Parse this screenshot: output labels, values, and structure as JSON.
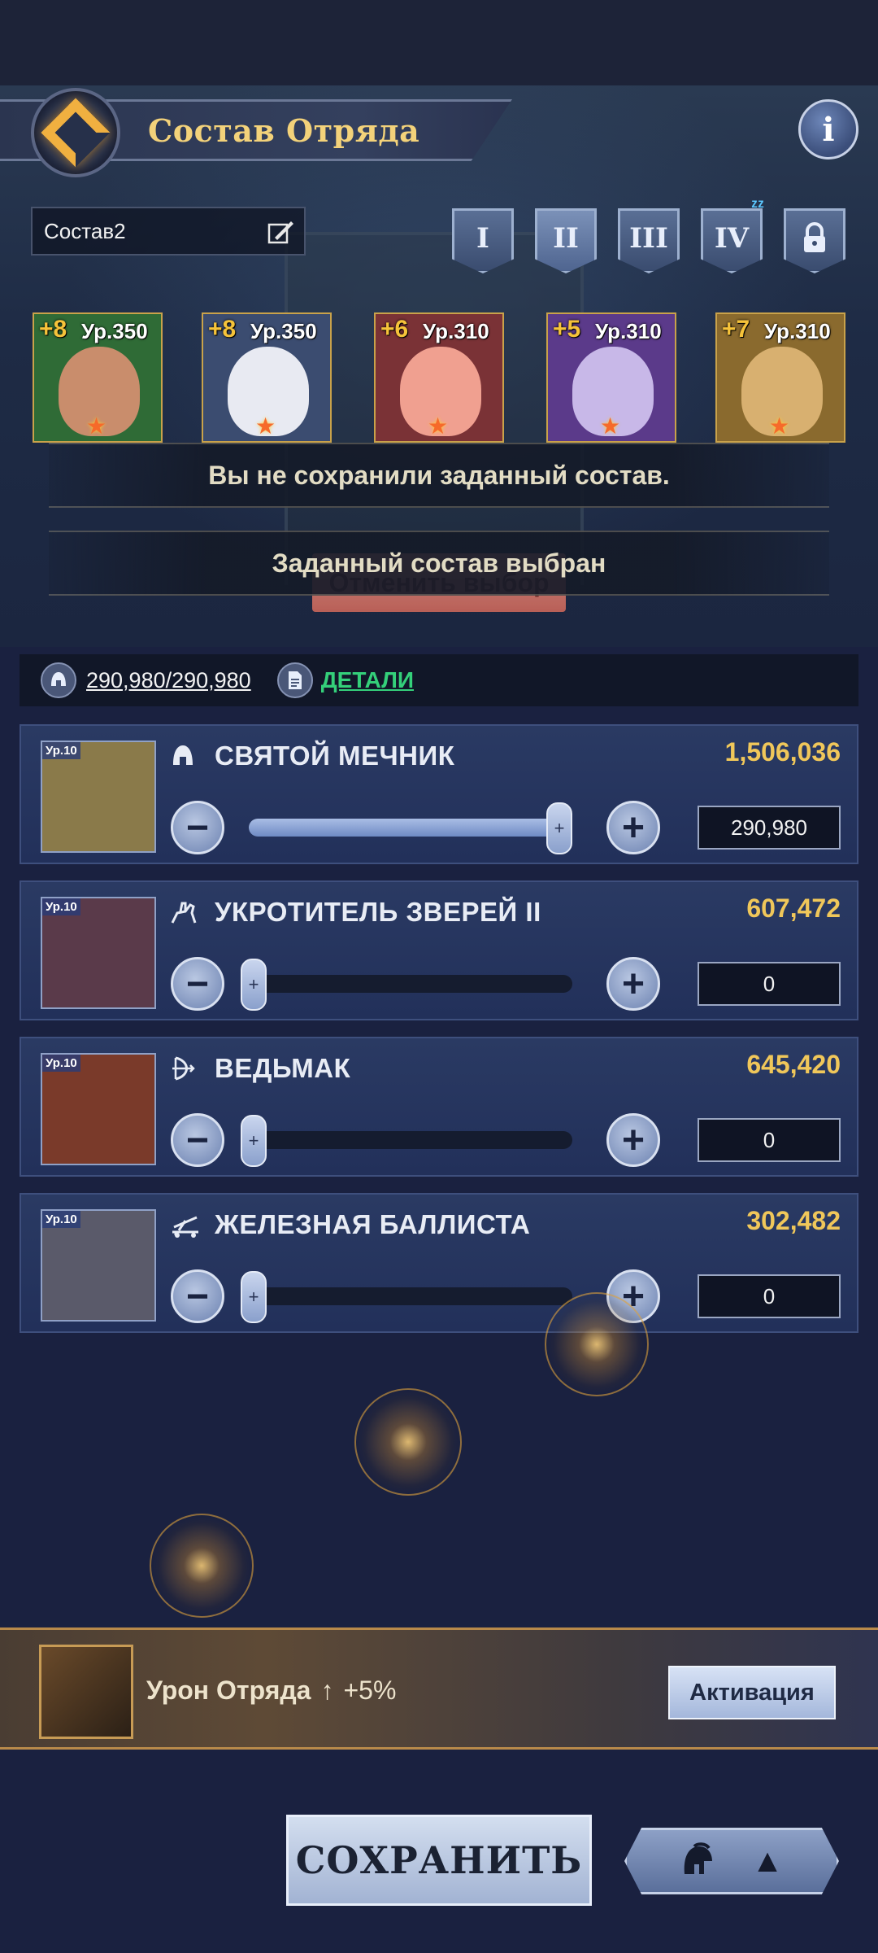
{
  "header": {
    "title": "Состав Отряда",
    "info_label": "i"
  },
  "formation": {
    "name": "Состав2"
  },
  "tabs": [
    {
      "label": "I"
    },
    {
      "label": "II"
    },
    {
      "label": "III"
    },
    {
      "label": "IV"
    },
    {
      "label": ""
    }
  ],
  "tab_badge": "zzz",
  "heroes": [
    {
      "plus": "+8",
      "level": "Ур.350",
      "bg": "#2f6b36",
      "face": "#c98d6c"
    },
    {
      "plus": "+8",
      "level": "Ур.350",
      "bg": "#3b4c70",
      "face": "#e8eaf2"
    },
    {
      "plus": "+6",
      "level": "Ур.310",
      "bg": "#7a3236",
      "face": "#f0a090"
    },
    {
      "plus": "+5",
      "level": "Ур.310",
      "bg": "#5b3a8a",
      "face": "#c8b8e8"
    },
    {
      "plus": "+7",
      "level": "Ур.310",
      "bg": "#8a6a2e",
      "face": "#d8b070"
    }
  ],
  "toasts": {
    "unsaved": "Вы не сохранили заданный состав.",
    "selected": "Заданный состав выбран",
    "cancel_button": "Отменить выбор"
  },
  "power": {
    "value": "290,980/290,980",
    "details_label": "ДЕТАЛИ"
  },
  "troops": [
    {
      "tag": "Ур.10",
      "name": "СВЯТОЙ МЕЧНИК",
      "power": "1,506,036",
      "qty": "290,980",
      "fill": 1.0,
      "icon": "helmet-icon",
      "portrait": "#8a7a4a"
    },
    {
      "tag": "Ур.10",
      "name": "УКРОТИТЕЛЬ ЗВЕРЕЙ II",
      "power": "607,472",
      "qty": "0",
      "fill": 0.0,
      "icon": "rider-icon",
      "portrait": "#5a3a4a"
    },
    {
      "tag": "Ур.10",
      "name": "ВЕДЬМАК",
      "power": "645,420",
      "qty": "0",
      "fill": 0.0,
      "icon": "bow-icon",
      "portrait": "#7a3a2a"
    },
    {
      "tag": "Ур.10",
      "name": "ЖЕЛЕЗНАЯ БАЛЛИСТА",
      "power": "302,482",
      "qty": "0",
      "fill": 0.0,
      "icon": "ballista-icon",
      "portrait": "#5a5a6a"
    }
  ],
  "buff": {
    "label": "Урон Отряда",
    "arrow": "↑",
    "value": "+5%",
    "activate_label": "Активация"
  },
  "bottom": {
    "save_label": "СОХРАНИТЬ",
    "preset_arrow": "▲"
  },
  "colors": {
    "gold": "#f0c75a",
    "green_link": "#34d07a",
    "panel": "#2a3a63"
  }
}
